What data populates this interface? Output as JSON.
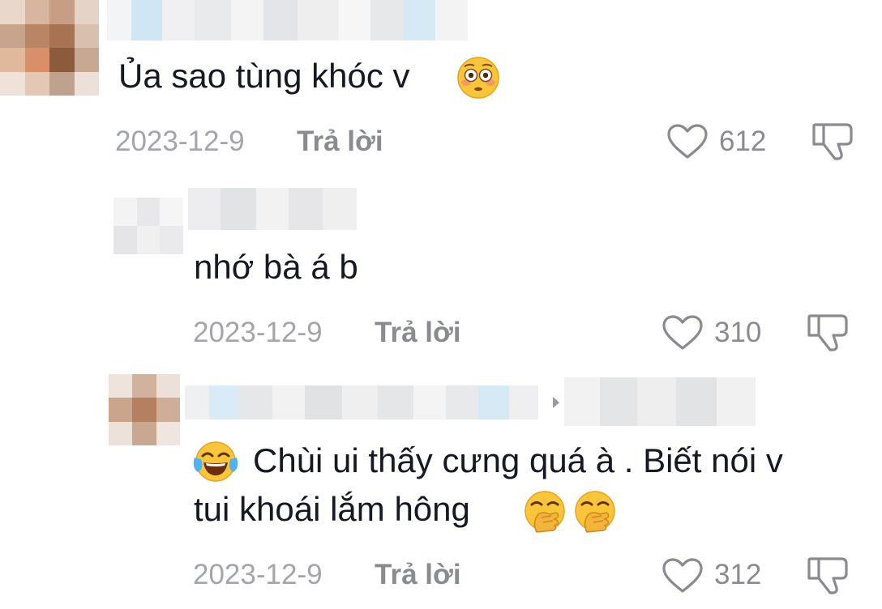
{
  "comments": [
    {
      "text": "Ủa sao tùng khóc v",
      "date": "2023-12-9",
      "reply_label": "Trả lời",
      "likes": "612",
      "emojis": [
        "flushed-face"
      ]
    },
    {
      "text": "nhớ bà á b",
      "date": "2023-12-9",
      "reply_label": "Trả lời",
      "likes": "310",
      "emojis": []
    },
    {
      "text_line1": "Chùi ui thấy cưng quá à . Biết nói v",
      "text_line2": "tui khoái lắm hông",
      "date": "2023-12-9",
      "reply_label": "Trả lời",
      "likes": "312",
      "emojis": [
        "tears-of-joy-face",
        "hand-over-mouth-face",
        "hand-over-mouth-face"
      ]
    }
  ],
  "colors": {
    "text": "#161823",
    "meta": "#a3a5aa",
    "action": "#8a8b91",
    "emoji_yellow": "#fbc53a"
  }
}
